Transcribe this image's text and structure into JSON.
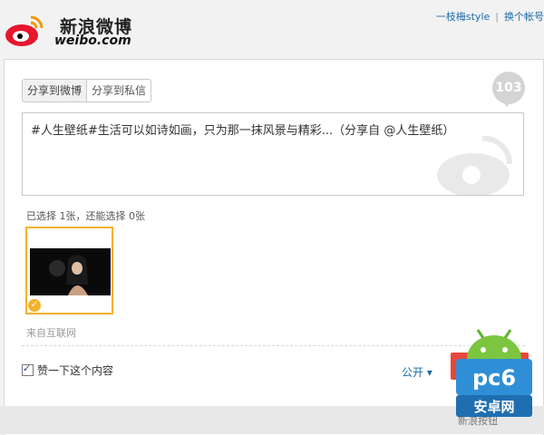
{
  "header": {
    "brand_cn": "新浪微博",
    "brand_en": "weibo.com",
    "user_link": "一枝梅style",
    "separator": "|",
    "switch_account": "换个帐号"
  },
  "share": {
    "tabs": [
      "分享到微博",
      "分享到私信"
    ],
    "char_count": "103",
    "text": "#人生壁纸#生活可以如诗如画，只为那一抹风景与精彩...（分享自 @人生壁纸）"
  },
  "images": {
    "selection_info": "已选择 1张，还能选择 0张",
    "source": "来自互联网"
  },
  "options": {
    "like_label": "赞一下这个内容",
    "privacy": "公开 ▾"
  },
  "footer": {
    "text": "新浪按钮"
  },
  "watermark": {
    "badge_text": "pc6",
    "site_text": "安卓网"
  },
  "colors": {
    "accent": "#1a6ca8",
    "highlight": "#f5b12c",
    "share_button": "#e7473c"
  }
}
